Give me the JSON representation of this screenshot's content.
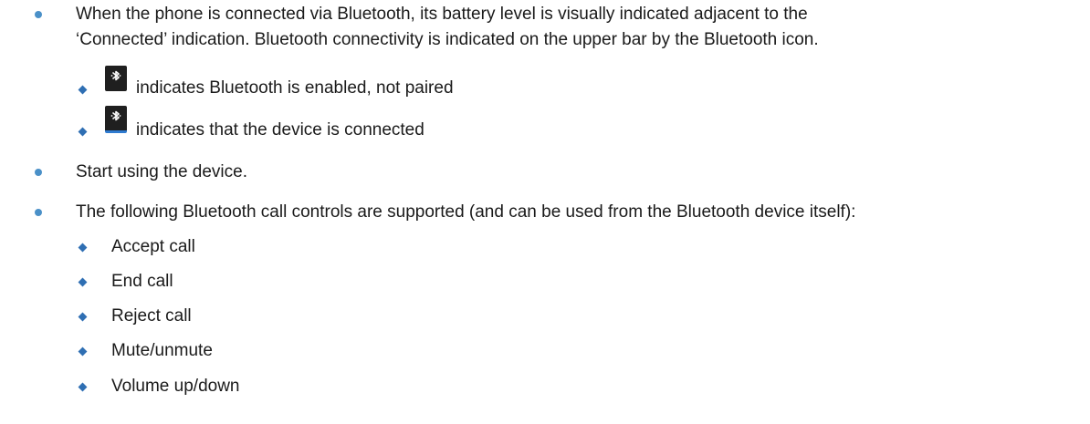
{
  "bullets": {
    "b1_line1": "When the phone is connected via Bluetooth, its battery level is visually indicated adjacent to the",
    "b1_line2": "‘Connected’ indication. Bluetooth connectivity is indicated on the upper bar by the Bluetooth icon.",
    "sub1": "indicates Bluetooth is enabled, not paired",
    "sub2": "indicates that the device is connected",
    "b2": "Start using the device.",
    "b3": "The following Bluetooth call controls are supported (and can be used from the Bluetooth device itself):",
    "controls": [
      "Accept call",
      "End call",
      "Reject call",
      "Mute/unmute",
      "Volume up/down"
    ]
  },
  "icons": {
    "enabled": "bluetooth-enabled-icon",
    "connected": "bluetooth-connected-icon"
  },
  "colors": {
    "dot_bullet": "#4a90c8",
    "diamond_bullet": "#2f6fb3",
    "icon_bg": "#1f1f1f",
    "connected_accent": "#2f7bd0"
  }
}
